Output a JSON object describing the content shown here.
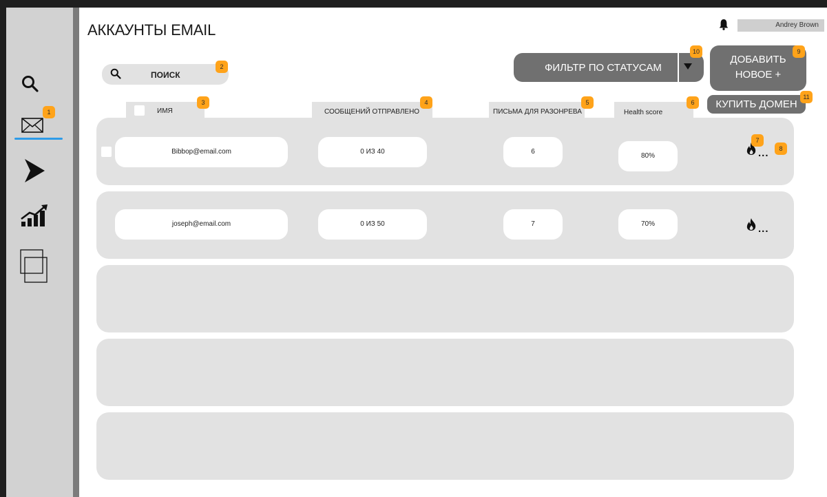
{
  "header": {
    "title": "АККАУНТЫ EMAIL",
    "user_name": "Andrey Brown"
  },
  "sidebar": {
    "items": [
      {
        "name": "search",
        "icon": "search-icon"
      },
      {
        "name": "email",
        "icon": "mail-icon",
        "active": true,
        "badge": "1"
      },
      {
        "name": "send",
        "icon": "send-arrow-icon"
      },
      {
        "name": "analytics",
        "icon": "chart-growth-icon"
      },
      {
        "name": "copy",
        "icon": "layers-icon"
      }
    ]
  },
  "search": {
    "label": "ПОИСК",
    "badge": "2"
  },
  "filter": {
    "label": "ФИЛЬТР ПО СТАТУСАМ",
    "badge": "10"
  },
  "add_button": {
    "line1": "ДОБАВИТЬ",
    "line2": "НОВОЕ +",
    "badge": "9"
  },
  "buy_domain": {
    "label": "КУПИТЬ ДОМЕН",
    "badge": "11"
  },
  "columns": {
    "name": {
      "label": "ИМЯ",
      "badge": "3"
    },
    "sent": {
      "label": "СООБЩЕНИЙ ОТПРАВЛЕНО",
      "badge": "4"
    },
    "warmup": {
      "label": "ПИСЬМА ДЛЯ РАЗОНРЕВА",
      "badge": "5"
    },
    "health": {
      "label": "Health score",
      "badge": "6"
    }
  },
  "rows": [
    {
      "email": "Bibbop@email.com",
      "sent": "0 ИЗ 40",
      "warmup": "6",
      "health": "80%",
      "badge_fire": "7",
      "badge_more": "8",
      "more": "..."
    },
    {
      "email": "joseph@email.com",
      "sent": "0 ИЗ 50",
      "warmup": "7",
      "health": "70%",
      "more": "..."
    }
  ],
  "colors": {
    "accent_badge": "#ffa31a",
    "active_underline": "#2d9be8",
    "button_bg": "#707070",
    "row_bg": "#e2e2e2"
  }
}
